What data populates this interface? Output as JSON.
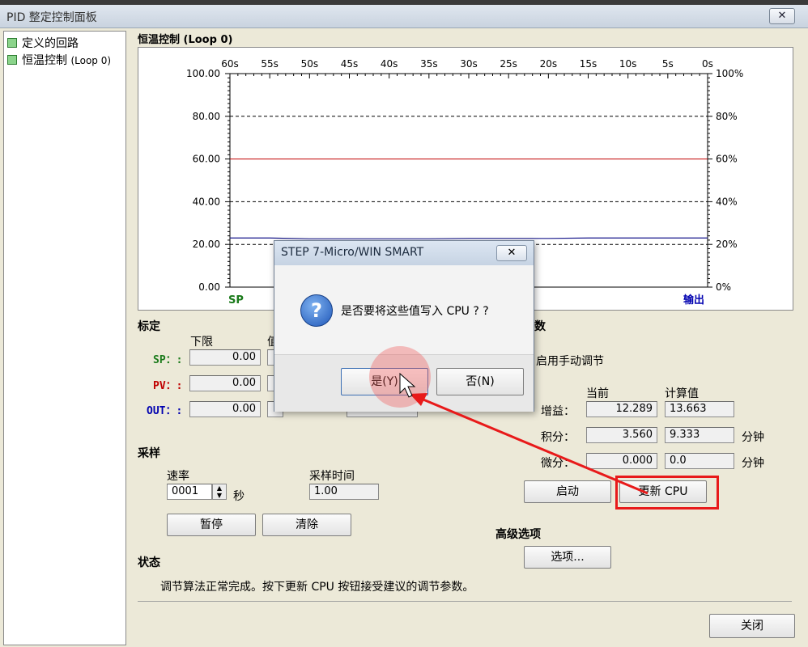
{
  "window": {
    "title": "PID 整定控制面板",
    "close": "✕"
  },
  "tree": [
    {
      "label": "定义的回路"
    },
    {
      "label": "恒温控制",
      "sub": "(Loop 0)"
    }
  ],
  "plot": {
    "title": "恒温控制 (Loop 0)",
    "time_ticks": [
      "60s",
      "55s",
      "50s",
      "45s",
      "40s",
      "35s",
      "30s",
      "25s",
      "20s",
      "15s",
      "10s",
      "5s",
      "0s"
    ],
    "left_ticks": [
      "100.00",
      "80.00",
      "60.00",
      "40.00",
      "20.00",
      "0.00"
    ],
    "right_ticks": [
      "100%",
      "80%",
      "60%",
      "40%",
      "20%",
      "0%"
    ],
    "sp_label": "SP",
    "output_label": "输出",
    "colors": {
      "sp": "#c00000",
      "pv": "#1a1a8c",
      "sp_text": "#1a7a1a",
      "out_text": "#0000b0"
    },
    "sp_value": 60.0,
    "pv_values": [
      23.0,
      23.0,
      22.6,
      22.6,
      22.6,
      22.6,
      22.8,
      22.8,
      22.8,
      23.0,
      23.0,
      23.0,
      23.0
    ]
  },
  "calibration": {
    "title": "标定",
    "lower_header": "下限",
    "value_header": "值",
    "rows": [
      {
        "name": "SP",
        "value": "0.00"
      },
      {
        "name": "PV",
        "value": "0.00"
      },
      {
        "name": "OUT",
        "value": "0.00"
      }
    ]
  },
  "sampling": {
    "title": "采样",
    "rate_label": "速率",
    "rate_value": "0001",
    "rate_unit": "秒",
    "time_label": "采样时间",
    "time_value": "1.00",
    "pause_button": "暂停",
    "clear_button": "清除"
  },
  "params": {
    "title": "数",
    "manual_label": "启用手动调节",
    "current_header": "当前",
    "calc_header": "计算值",
    "rows": [
      {
        "label": "增益：",
        "current": "12.289",
        "calc": "13.663",
        "unit": ""
      },
      {
        "label": "积分：",
        "current": "3.560",
        "calc": "9.333",
        "unit": "分钟"
      },
      {
        "label": "微分：",
        "current": "0.000",
        "calc": "0.0",
        "unit": "分钟"
      }
    ],
    "start_button": "启动",
    "update_button": "更新 CPU"
  },
  "advanced": {
    "title": "高级选项",
    "options_button": "选项..."
  },
  "status": {
    "title": "状态",
    "message": "调节算法正常完成。按下更新 CPU 按钮接受建议的调节参数。"
  },
  "close_button": "关闭",
  "dialog": {
    "title": "STEP 7-Micro/WIN SMART",
    "close": "✕",
    "message": "是否要将这些值写入 CPU ? ?",
    "yes": "是(Y)",
    "no": "否(N)"
  }
}
